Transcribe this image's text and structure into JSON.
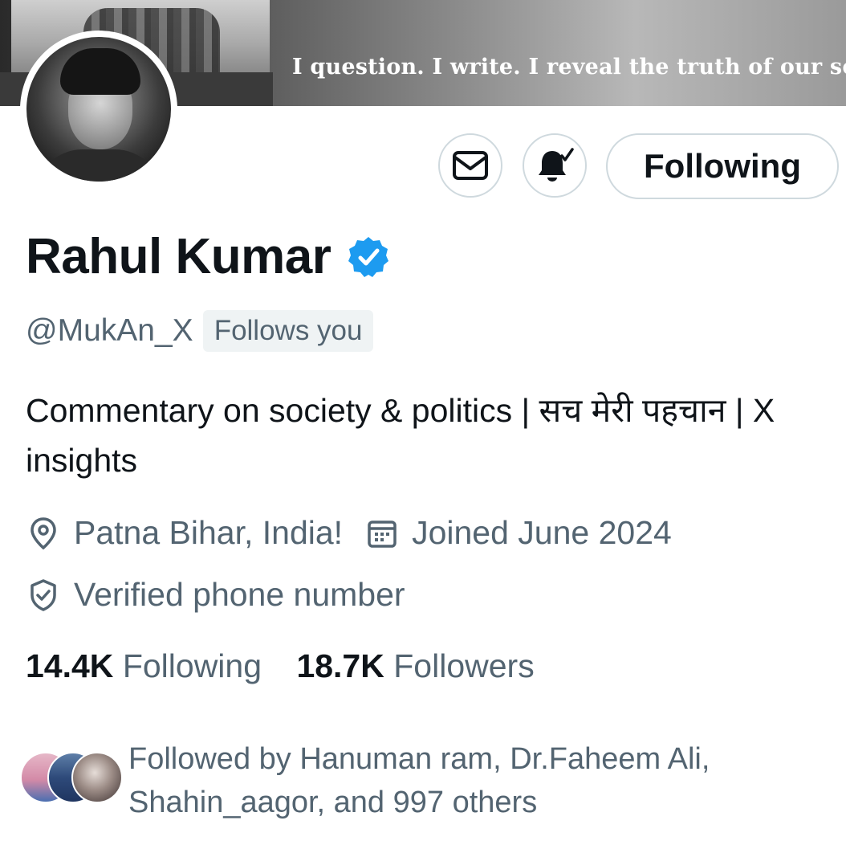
{
  "banner": {
    "quote": "I question. I write. I reveal the truth of our society"
  },
  "actions": {
    "message_icon": "mail-icon",
    "notify_icon": "bell-check-icon",
    "follow_label": "Following"
  },
  "profile": {
    "name": "Rahul Kumar",
    "verified_color": "#1d9bf0",
    "handle": "@MukAn_X",
    "follows_you": "Follows you",
    "bio": "Commentary on society & politics | सच मेरी पहचान | X insights",
    "location": "Patna Bihar, India!",
    "joined": "Joined June 2024",
    "verified_phone": "Verified phone number"
  },
  "stats": {
    "following_count": "14.4K",
    "following_label": "Following",
    "followers_count": "18.7K",
    "followers_label": "Followers"
  },
  "followed_by": {
    "text": "Followed by Hanuman ram, Dr.Faheem Ali, Shahin_aagor, and 997 others"
  },
  "colors": {
    "accent": "#1d9bf0",
    "secondary_text": "#536471",
    "border": "#cfd9de"
  }
}
